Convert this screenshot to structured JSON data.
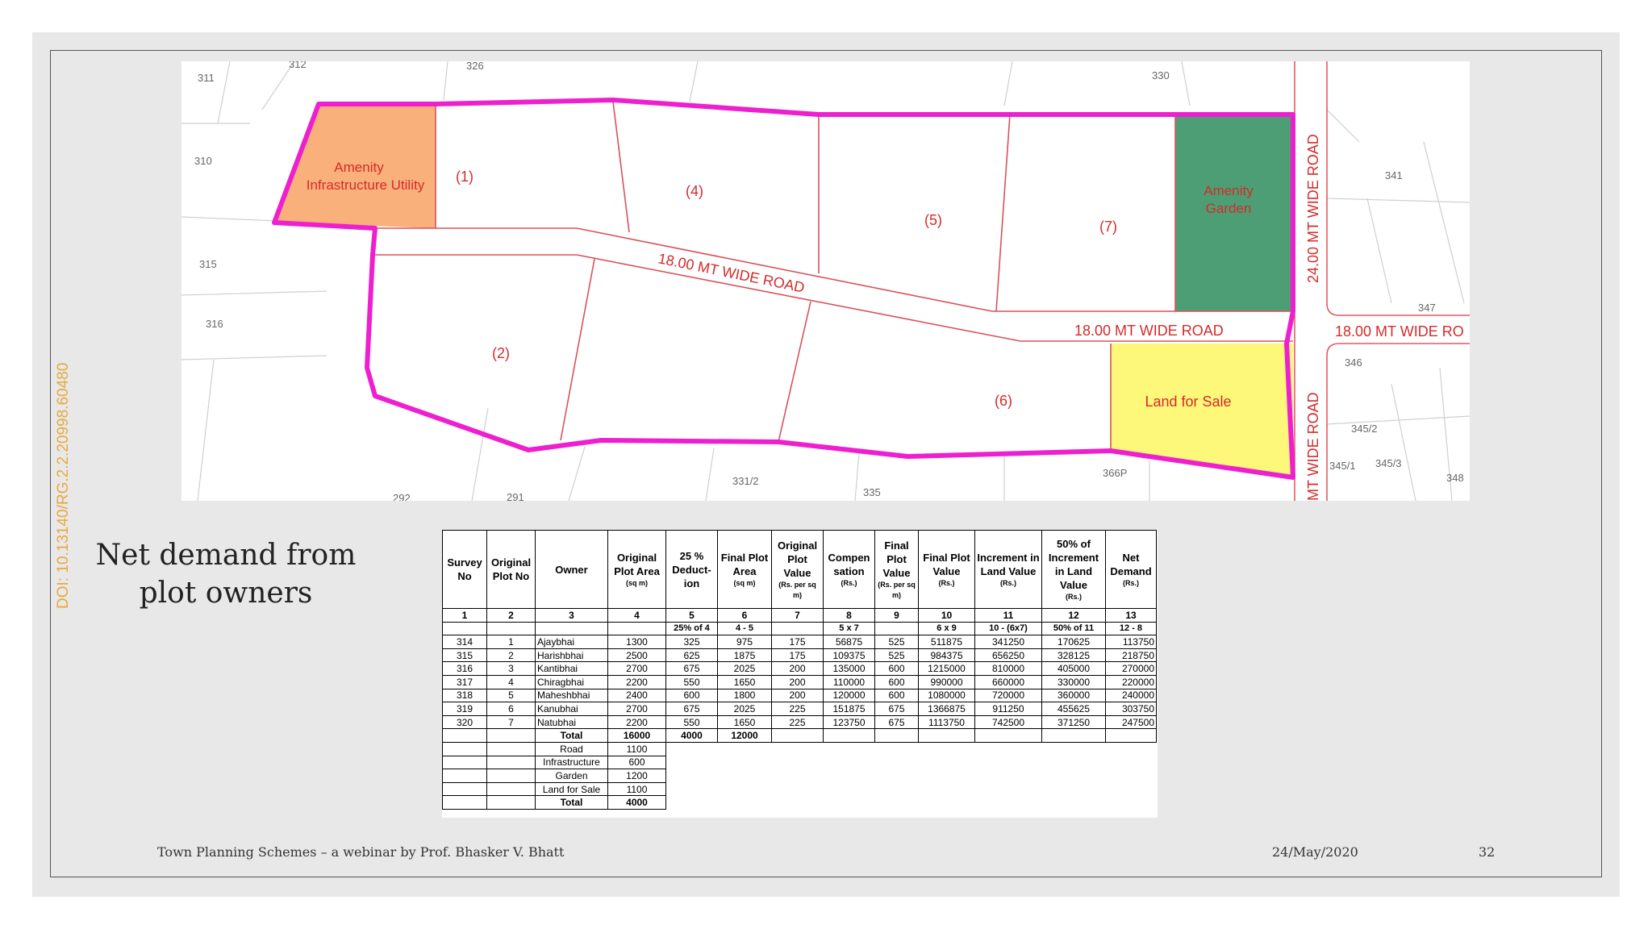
{
  "doi": "DOI: 10.13140/RG.2.2.20998.60480",
  "slide_title": "Net demand from plot owners",
  "map": {
    "survey_numbers": [
      "311",
      "312",
      "326",
      "330",
      "310",
      "315",
      "316",
      "341",
      "347",
      "346",
      "345/2",
      "345/1",
      "345/3",
      "348",
      "331/2",
      "335",
      "366P",
      "292",
      "291"
    ],
    "plot_labels": [
      "(1)",
      "(2)",
      "(4)",
      "(5)",
      "(6)",
      "(7)"
    ],
    "amenity_infra": [
      "Amenity",
      "Infrastructure Utility"
    ],
    "amenity_garden": [
      "Amenity",
      "Garden"
    ],
    "land_for_sale": "Land for Sale",
    "road_diag": "18.00 MT WIDE ROAD",
    "road_mid": "18.00 MT WIDE ROAD",
    "road_right": "18.00 MT WIDE RO",
    "road_vert_top": "24.00 MT WIDE ROAD",
    "road_vert_bot": "MT WIDE ROAD",
    "colors": {
      "boundary": "#ee1fcf",
      "plot_line": "#d9525b",
      "infra_fill": "#f9b07a",
      "garden_fill": "#4d9e74",
      "sale_fill": "#fdf77a",
      "label_red": "#d62a2a"
    }
  },
  "table": {
    "headers": [
      {
        "t": "Survey No",
        "u": ""
      },
      {
        "t": "Original Plot No",
        "u": ""
      },
      {
        "t": "Owner",
        "u": ""
      },
      {
        "t": "Original Plot Area",
        "u": "(sq m)"
      },
      {
        "t": "25 % Deduct-ion",
        "u": ""
      },
      {
        "t": "Final Plot Area",
        "u": "(sq m)"
      },
      {
        "t": "Original Plot Value",
        "u": "(Rs. per sq m)"
      },
      {
        "t": "Compen sation",
        "u": "(Rs.)"
      },
      {
        "t": "Final Plot Value",
        "u": "(Rs. per sq m)"
      },
      {
        "t": "Final Plot Value",
        "u": "(Rs.)"
      },
      {
        "t": "Increment in Land Value",
        "u": "(Rs.)"
      },
      {
        "t": "50% of Increment in Land Value",
        "u": "(Rs.)"
      },
      {
        "t": "Net Demand",
        "u": "(Rs.)"
      }
    ],
    "col_numbers": [
      "1",
      "2",
      "3",
      "4",
      "5",
      "6",
      "7",
      "8",
      "9",
      "10",
      "11",
      "12",
      "13"
    ],
    "formulas": [
      "",
      "",
      "",
      "",
      "25% of 4",
      "4 - 5",
      "",
      "5 x 7",
      "",
      "6 x 9",
      "10 - (6x7)",
      "50% of 11",
      "12 - 8"
    ],
    "rows": [
      [
        "314",
        "1",
        "Ajaybhai",
        "1300",
        "325",
        "975",
        "175",
        "56875",
        "525",
        "511875",
        "341250",
        "170625",
        "113750"
      ],
      [
        "315",
        "2",
        "Harishbhai",
        "2500",
        "625",
        "1875",
        "175",
        "109375",
        "525",
        "984375",
        "656250",
        "328125",
        "218750"
      ],
      [
        "316",
        "3",
        "Kantibhai",
        "2700",
        "675",
        "2025",
        "200",
        "135000",
        "600",
        "1215000",
        "810000",
        "405000",
        "270000"
      ],
      [
        "317",
        "4",
        "Chiragbhai",
        "2200",
        "550",
        "1650",
        "200",
        "110000",
        "600",
        "990000",
        "660000",
        "330000",
        "220000"
      ],
      [
        "318",
        "5",
        "Maheshbhai",
        "2400",
        "600",
        "1800",
        "200",
        "120000",
        "600",
        "1080000",
        "720000",
        "360000",
        "240000"
      ],
      [
        "319",
        "6",
        "Kanubhai",
        "2700",
        "675",
        "2025",
        "225",
        "151875",
        "675",
        "1366875",
        "911250",
        "455625",
        "303750"
      ],
      [
        "320",
        "7",
        "Natubhai",
        "2200",
        "550",
        "1650",
        "225",
        "123750",
        "675",
        "1113750",
        "742500",
        "371250",
        "247500"
      ]
    ],
    "total_row": {
      "label": "Total",
      "area": "16000",
      "deduction": "4000",
      "final": "12000"
    },
    "deduction_rows": [
      {
        "label": "Road",
        "value": "1100"
      },
      {
        "label": "Infrastructure",
        "value": "600"
      },
      {
        "label": "Garden",
        "value": "1200"
      },
      {
        "label": "Land for Sale",
        "value": "1100"
      }
    ],
    "deduction_total": {
      "label": "Total",
      "value": "4000"
    }
  },
  "footer": {
    "left": "Town Planning Schemes – a webinar by Prof. Bhasker V. Bhatt",
    "date": "24/May/2020",
    "page": "32"
  }
}
